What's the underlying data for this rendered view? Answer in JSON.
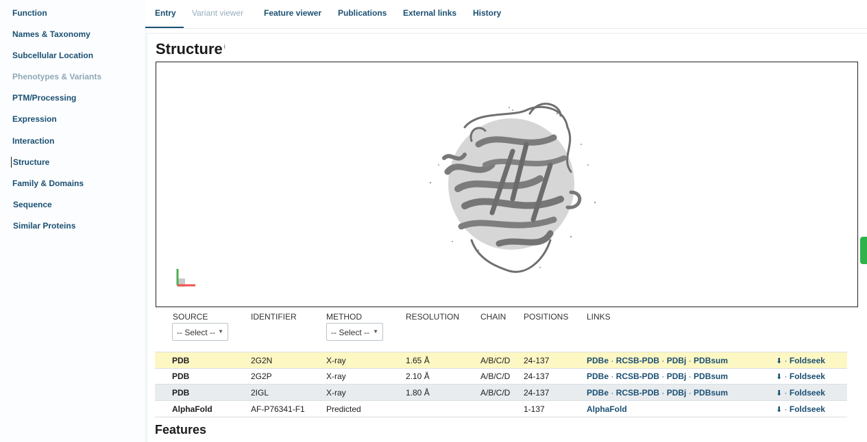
{
  "sidebar": {
    "items": [
      {
        "label": "Function",
        "state": "normal"
      },
      {
        "label": "Names & Taxonomy",
        "state": "normal"
      },
      {
        "label": "Subcellular Location",
        "state": "normal"
      },
      {
        "label": "Phenotypes & Variants",
        "state": "disabled"
      },
      {
        "label": "PTM/Processing",
        "state": "normal"
      },
      {
        "label": "Expression",
        "state": "normal"
      },
      {
        "label": "Interaction",
        "state": "normal"
      },
      {
        "label": "Structure",
        "state": "active"
      },
      {
        "label": "Family & Domains",
        "state": "normal"
      },
      {
        "label": "Sequence",
        "state": "normal"
      },
      {
        "label": "Similar Proteins",
        "state": "normal"
      }
    ]
  },
  "tabs": [
    {
      "label": "Entry",
      "state": "active"
    },
    {
      "label": "Variant viewer",
      "state": "disabled"
    },
    {
      "label": "Feature viewer",
      "state": "normal"
    },
    {
      "label": "Publications",
      "state": "normal"
    },
    {
      "label": "External links",
      "state": "normal"
    },
    {
      "label": "History",
      "state": "normal"
    }
  ],
  "structure": {
    "title": "Structure",
    "info_mark": "i",
    "columns": [
      "SOURCE",
      "IDENTIFIER",
      "METHOD",
      "RESOLUTION",
      "CHAIN",
      "POSITIONS",
      "LINKS"
    ],
    "source_select": "-- Select --",
    "method_select": "-- Select --",
    "rows": [
      {
        "source": "PDB",
        "identifier": "2G2N",
        "method": "X-ray",
        "resolution": "1.65 Å",
        "chain": "A/B/C/D",
        "positions": "24-137",
        "links": [
          "PDBe",
          "RCSB-PDB",
          "PDBj",
          "PDBsum"
        ],
        "foldseek": "Foldseek"
      },
      {
        "source": "PDB",
        "identifier": "2G2P",
        "method": "X-ray",
        "resolution": "2.10 Å",
        "chain": "A/B/C/D",
        "positions": "24-137",
        "links": [
          "PDBe",
          "RCSB-PDB",
          "PDBj",
          "PDBsum"
        ],
        "foldseek": "Foldseek"
      },
      {
        "source": "PDB",
        "identifier": "2IGL",
        "method": "X-ray",
        "resolution": "1.80 Å",
        "chain": "A/B/C/D",
        "positions": "24-137",
        "links": [
          "PDBe",
          "RCSB-PDB",
          "PDBj",
          "PDBsum"
        ],
        "foldseek": "Foldseek"
      },
      {
        "source": "AlphaFold",
        "identifier": "AF-P76341-F1",
        "method": "Predicted",
        "resolution": "",
        "chain": "",
        "positions": "1-137",
        "links": [
          "AlphaFold"
        ],
        "foldseek": "Foldseek"
      }
    ],
    "link_separator": " · "
  },
  "features": {
    "title": "Features"
  },
  "colors": {
    "link": "#1a4f72",
    "highlight_row": "#fdf7c4",
    "accent_green": "#2db34a"
  }
}
